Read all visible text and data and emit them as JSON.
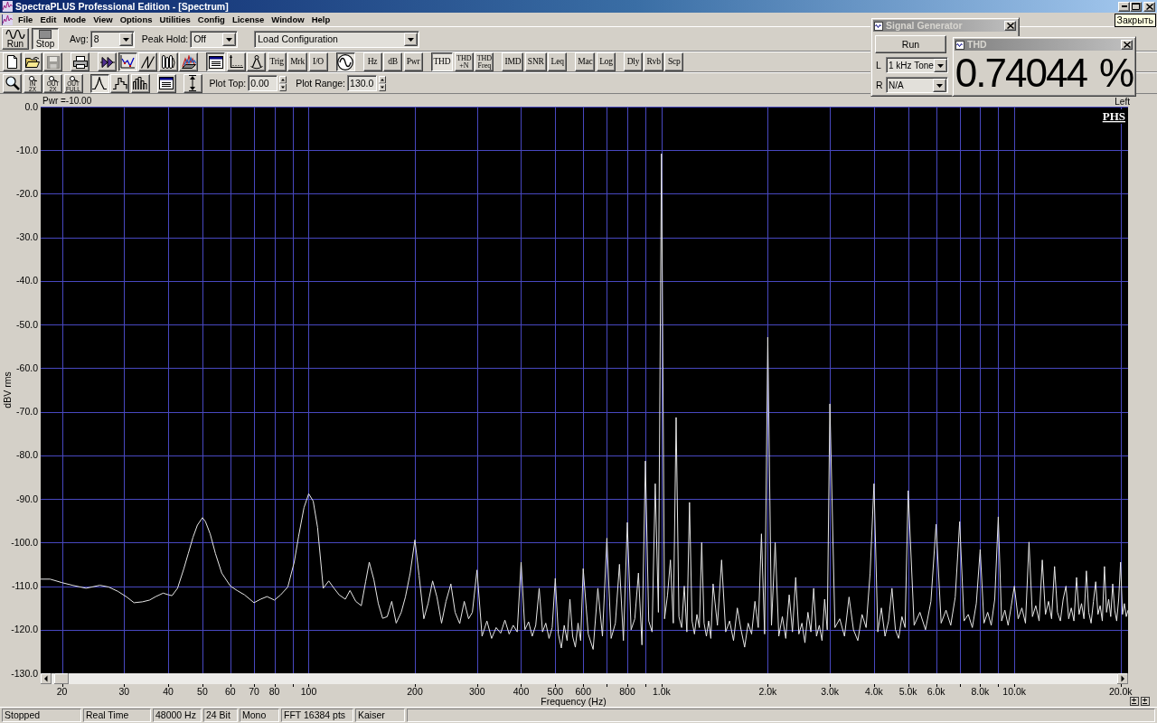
{
  "window": {
    "title": "SpectraPLUS Professional Edition - [Spectrum]",
    "tooltip": "Закрыть"
  },
  "menu": [
    "File",
    "Edit",
    "Mode",
    "View",
    "Options",
    "Utilities",
    "Config",
    "License",
    "Window",
    "Help"
  ],
  "main_toolbar": {
    "transport": [
      {
        "label": "Run",
        "pressed": false
      },
      {
        "label": "Stop",
        "pressed": true
      }
    ],
    "fields": [
      {
        "label": "Avg:",
        "value": "8"
      },
      {
        "label": "Peak Hold:",
        "value": "Off"
      },
      {
        "value": "Load Configuration"
      }
    ]
  },
  "tools_toolbar": {
    "groups": [
      {
        "buttons": [
          {
            "kind": "icon",
            "pressed": false,
            "disabled": false
          },
          {
            "kind": "icon",
            "pressed": false,
            "disabled": false
          },
          {
            "kind": "icon",
            "pressed": false,
            "disabled": true
          }
        ]
      },
      {
        "buttons": [
          {
            "kind": "icon",
            "pressed": false,
            "disabled": false
          }
        ]
      },
      {
        "buttons": [
          {
            "kind": "icon",
            "pressed": false,
            "disabled": false
          },
          {
            "kind": "icon",
            "pressed": true,
            "disabled": false
          },
          {
            "kind": "icon",
            "pressed": false,
            "disabled": false
          },
          {
            "kind": "icon",
            "pressed": false,
            "disabled": false
          },
          {
            "kind": "icon",
            "pressed": false,
            "disabled": false
          }
        ]
      },
      {
        "buttons": [
          {
            "kind": "icon",
            "pressed": true,
            "disabled": false
          },
          {
            "kind": "icon",
            "pressed": false,
            "disabled": false
          },
          {
            "kind": "icon",
            "pressed": false,
            "disabled": false
          },
          {
            "kind": "text",
            "label": "Trig",
            "pressed": false,
            "disabled": false
          },
          {
            "kind": "text",
            "label": "Mrk",
            "pressed": false,
            "disabled": false
          },
          {
            "kind": "text",
            "label": "I/O",
            "pressed": false,
            "disabled": false
          }
        ]
      },
      {
        "buttons": [
          {
            "kind": "icon",
            "pressed": true,
            "disabled": false
          }
        ]
      },
      {
        "buttons": [
          {
            "kind": "text",
            "label": "Hz",
            "pressed": false,
            "disabled": false
          },
          {
            "kind": "text",
            "label": "dB",
            "pressed": false,
            "disabled": false
          },
          {
            "kind": "text",
            "label": "Pwr",
            "pressed": false,
            "disabled": false
          }
        ]
      },
      {
        "buttons": [
          {
            "kind": "text",
            "label": "THD",
            "pressed": true,
            "disabled": false
          },
          {
            "kind": "stacked",
            "label": "THD +N",
            "pressed": false,
            "disabled": false
          },
          {
            "kind": "stacked",
            "label": "THD Freq",
            "pressed": false,
            "disabled": false
          }
        ]
      },
      {
        "buttons": [
          {
            "kind": "text",
            "label": "IMD",
            "pressed": false,
            "disabled": false
          },
          {
            "kind": "text",
            "label": "SNR",
            "pressed": false,
            "disabled": false
          },
          {
            "kind": "text",
            "label": "Leq",
            "pressed": false,
            "disabled": false
          }
        ]
      },
      {
        "buttons": [
          {
            "kind": "text",
            "label": "Mac",
            "pressed": false,
            "disabled": false
          },
          {
            "kind": "text",
            "label": "Log",
            "pressed": false,
            "disabled": false
          }
        ]
      },
      {
        "buttons": [
          {
            "kind": "text",
            "label": "Dly",
            "pressed": false,
            "disabled": false
          },
          {
            "kind": "text",
            "label": "Rvb",
            "pressed": false,
            "disabled": false
          },
          {
            "kind": "text",
            "label": "Scp",
            "pressed": false,
            "disabled": false
          }
        ]
      }
    ]
  },
  "view_toolbar": {
    "groups": [
      {
        "buttons": [
          {
            "kind": "icon",
            "pressed": false,
            "disabled": false
          },
          {
            "kind": "zoom",
            "label": "IN 2X",
            "pressed": false,
            "disabled": false
          },
          {
            "kind": "zoom",
            "label": "OUT 2X",
            "pressed": false,
            "disabled": false
          },
          {
            "kind": "zoom",
            "label": "OUT FULL",
            "pressed": false,
            "disabled": false
          }
        ]
      },
      {
        "buttons": [
          {
            "kind": "icon",
            "pressed": true,
            "disabled": false
          },
          {
            "kind": "icon",
            "pressed": false,
            "disabled": false
          },
          {
            "kind": "icon",
            "pressed": false,
            "disabled": false
          }
        ]
      },
      {
        "buttons": [
          {
            "kind": "icon",
            "pressed": false,
            "disabled": false
          }
        ]
      },
      {
        "buttons": [
          {
            "kind": "icon",
            "pressed": false,
            "disabled": false
          }
        ]
      }
    ],
    "fields": [
      {
        "label": "Plot Top:",
        "value": "0.00"
      },
      {
        "label": "Plot Range:",
        "value": "130.0"
      }
    ]
  },
  "spectrum": {
    "readout": "Pwr =-10.00",
    "logo": "PHS",
    "chart_data": {
      "type": "line",
      "xlabel": "Frequency (Hz)",
      "ylabel": "dBV rms",
      "log": "x",
      "grid": true,
      "xlim": [
        17.4,
        21000
      ],
      "ylim": [
        -130,
        0
      ],
      "xticks": [
        {
          "value": 20,
          "label": "20"
        },
        {
          "value": 30,
          "label": "30"
        },
        {
          "value": 40,
          "label": "40"
        },
        {
          "value": 50,
          "label": "50"
        },
        {
          "value": 60,
          "label": "60"
        },
        {
          "value": 70,
          "label": "70"
        },
        {
          "value": 80,
          "label": "80"
        },
        {
          "value": 100,
          "label": "100"
        },
        {
          "value": 200,
          "label": "200"
        },
        {
          "value": 300,
          "label": "300"
        },
        {
          "value": 400,
          "label": "400"
        },
        {
          "value": 500,
          "label": "500"
        },
        {
          "value": 600,
          "label": "600"
        },
        {
          "value": 800,
          "label": "800"
        },
        {
          "value": 1000,
          "label": "1.0k"
        },
        {
          "value": 2000,
          "label": "2.0k"
        },
        {
          "value": 3000,
          "label": "3.0k"
        },
        {
          "value": 4000,
          "label": "4.0k"
        },
        {
          "value": 5000,
          "label": "5.0k"
        },
        {
          "value": 6000,
          "label": "6.0k"
        },
        {
          "value": 8000,
          "label": "8.0k"
        },
        {
          "value": 10000,
          "label": "10.0k"
        },
        {
          "value": 20000,
          "label": "20.0k"
        }
      ],
      "yticks": [
        {
          "value": 0,
          "label": "0.0"
        },
        {
          "value": -10,
          "label": "-10.0"
        },
        {
          "value": -20,
          "label": "-20.0"
        },
        {
          "value": -30,
          "label": "-30.0"
        },
        {
          "value": -40,
          "label": "-40.0"
        },
        {
          "value": -50,
          "label": "-50.0"
        },
        {
          "value": -60,
          "label": "-60.0"
        },
        {
          "value": -70,
          "label": "-70.0"
        },
        {
          "value": -80,
          "label": "-80.0"
        },
        {
          "value": -90,
          "label": "-90.0"
        },
        {
          "value": -100,
          "label": "-100.0"
        },
        {
          "value": -110,
          "label": "-110.0"
        },
        {
          "value": -120,
          "label": "-120.0"
        },
        {
          "value": -130,
          "label": "-130.0"
        }
      ],
      "x": [
        17.4,
        18.5,
        20,
        21.4,
        23.4,
        25.6,
        27.1,
        28.8,
        30.5,
        32,
        33.8,
        35.4,
        36.9,
        38.7,
        40.1,
        41,
        42.5,
        44.3,
        45.6,
        47,
        48.4,
        50,
        51,
        52.6,
        54.4,
        56.7,
        60,
        62.7,
        65.8,
        70,
        73.1,
        76.2,
        80,
        83.3,
        87.3,
        91,
        93.7,
        97,
        100,
        103,
        106,
        110,
        114,
        118,
        122,
        127,
        131,
        136,
        141,
        145,
        148.5,
        153,
        157.5,
        162,
        167,
        172,
        177,
        183,
        188,
        194,
        200,
        205.5,
        212,
        218,
        224.5,
        231,
        238,
        245,
        253,
        260,
        268,
        276,
        284,
        291,
        300,
        310,
        320,
        330,
        340,
        350,
        360,
        370,
        380,
        390,
        400,
        410,
        420,
        430,
        440,
        450,
        460,
        470,
        480,
        490,
        500,
        510,
        520,
        530,
        540,
        550,
        560,
        570,
        580,
        590,
        600,
        620,
        640,
        660,
        680,
        700,
        720,
        740,
        760,
        780,
        800,
        820,
        840,
        860,
        880,
        900,
        920,
        940,
        960,
        980,
        1000,
        1020,
        1040,
        1060,
        1080,
        1100,
        1120,
        1140,
        1160,
        1180,
        1200,
        1220,
        1240,
        1260,
        1280,
        1300,
        1320,
        1340,
        1360,
        1380,
        1400,
        1440,
        1480,
        1520,
        1560,
        1600,
        1640,
        1680,
        1720,
        1760,
        1800,
        1840,
        1880,
        1920,
        1960,
        2000,
        2050,
        2100,
        2150,
        2200,
        2250,
        2300,
        2350,
        2400,
        2450,
        2500,
        2550,
        2600,
        2650,
        2700,
        2750,
        2800,
        2850,
        2900,
        2950,
        3000,
        3100,
        3200,
        3300,
        3400,
        3500,
        3600,
        3700,
        3800,
        3900,
        4000,
        4100,
        4200,
        4300,
        4400,
        4500,
        4600,
        4700,
        4800,
        4900,
        5000,
        5200,
        5400,
        5600,
        5800,
        6000,
        6200,
        6400,
        6600,
        6800,
        7000,
        7200,
        7400,
        7600,
        7800,
        8000,
        8200,
        8400,
        8600,
        8800,
        9000,
        9200,
        9400,
        9600,
        9800,
        10000,
        10250,
        10500,
        10750,
        11000,
        11250,
        11500,
        11750,
        12000,
        12250,
        12500,
        12750,
        13000,
        13250,
        13500,
        13750,
        14000,
        14250,
        14500,
        14750,
        15000,
        15250,
        15500,
        15750,
        16000,
        16250,
        16500,
        16750,
        17000,
        17250,
        17500,
        17750,
        18000,
        18250,
        18500,
        18750,
        19000,
        19250,
        19500,
        19750,
        20000,
        20250,
        20500,
        20750,
        21000
      ],
      "series": [
        {
          "name": "Left",
          "color": "#e6e6e6",
          "values": [
            -108.4,
            -108.4,
            -109.2,
            -109.8,
            -110.5,
            -109.8,
            -110.2,
            -111.2,
            -112.5,
            -113.8,
            -113.6,
            -113.2,
            -112.4,
            -111.6,
            -112.0,
            -112.2,
            -110.5,
            -106.0,
            -102.5,
            -98.8,
            -96.0,
            -94.3,
            -95.2,
            -98.0,
            -102.5,
            -107.0,
            -110.0,
            -111.0,
            -112.0,
            -113.8,
            -113.0,
            -112.4,
            -113.2,
            -112.0,
            -110.2,
            -104.5,
            -98.5,
            -92.0,
            -88.8,
            -90.5,
            -96.5,
            -110.5,
            -108.8,
            -110.5,
            -112.0,
            -113.0,
            -111.0,
            -113.5,
            -114.5,
            -109.0,
            -104.5,
            -108.5,
            -114.0,
            -117.4,
            -117.0,
            -113.5,
            -118.5,
            -116.0,
            -112.5,
            -107.0,
            -99.4,
            -107.5,
            -117.5,
            -114.0,
            -108.8,
            -112.5,
            -118.5,
            -113.5,
            -109.5,
            -116.0,
            -118.6,
            -113.5,
            -117.5,
            -116.0,
            -106.3,
            -121.5,
            -118.0,
            -122.0,
            -119.5,
            -120.8,
            -117.8,
            -121.0,
            -119.0,
            -120.5,
            -104.5,
            -120.0,
            -118.2,
            -121.5,
            -119.0,
            -110.5,
            -120.5,
            -118.5,
            -122.0,
            -119.5,
            -108.2,
            -121.0,
            -124.2,
            -119.0,
            -122.5,
            -113.0,
            -121.5,
            -124.0,
            -118.5,
            -122.5,
            -106.0,
            -121.0,
            -124.5,
            -110.5,
            -121.5,
            -99.0,
            -122.0,
            -118.5,
            -105.0,
            -122.5,
            -95.4,
            -120.0,
            -117.5,
            -107.0,
            -123.5,
            -81.3,
            -118.0,
            -120.5,
            -86.5,
            -116.0,
            -10.8,
            -117.5,
            -112.0,
            -104.0,
            -118.5,
            -71.3,
            -117.0,
            -119.5,
            -110.0,
            -120.5,
            -90.8,
            -118.0,
            -121.0,
            -116.5,
            -119.5,
            -100.0,
            -118.5,
            -121.5,
            -118.0,
            -122.0,
            -109.5,
            -119.0,
            -104.0,
            -120.5,
            -118.0,
            -122.5,
            -115.0,
            -120.0,
            -124.0,
            -118.5,
            -121.0,
            -113.5,
            -119.5,
            -98.0,
            -121.0,
            -52.9,
            -119.0,
            -100.0,
            -121.5,
            -117.0,
            -122.0,
            -112.0,
            -120.5,
            -108.0,
            -121.0,
            -118.5,
            -123.0,
            -116.0,
            -120.5,
            -110.5,
            -121.5,
            -119.0,
            -122.5,
            -113.0,
            -120.0,
            -68.2,
            -119.5,
            -117.5,
            -121.5,
            -112.5,
            -120.0,
            -122.5,
            -116.5,
            -119.5,
            -107.0,
            -86.5,
            -120.5,
            -115.0,
            -121.5,
            -118.0,
            -110.5,
            -120.0,
            -122.0,
            -117.0,
            -119.5,
            -88.1,
            -119.0,
            -116.0,
            -120.0,
            -113.5,
            -95.8,
            -118.5,
            -115.5,
            -119.0,
            -112.5,
            -95.2,
            -118.0,
            -116.5,
            -119.5,
            -114.0,
            -101.6,
            -118.5,
            -116.0,
            -119.0,
            -113.0,
            -94.1,
            -118.0,
            -115.5,
            -119.0,
            -114.5,
            -110.0,
            -117.5,
            -115.0,
            -118.5,
            -99.9,
            -117.0,
            -114.5,
            -118.0,
            -104.0,
            -116.5,
            -113.5,
            -117.5,
            -105.5,
            -116.0,
            -118.0,
            -113.0,
            -110.0,
            -117.5,
            -115.0,
            -118.0,
            -108.0,
            -116.5,
            -114.0,
            -117.5,
            -106.5,
            -116.0,
            -118.5,
            -113.5,
            -109.0,
            -116.5,
            -114.5,
            -118.0,
            -105.5,
            -116.0,
            -113.0,
            -117.0,
            -109.5,
            -115.5,
            -118.0,
            -113.0,
            -104.5,
            -116.5,
            -114.0,
            -117.0,
            -115.5
          ]
        }
      ]
    }
  },
  "status_bar": [
    "Stopped",
    "Real Time",
    "48000 Hz",
    "24 Bit",
    "Mono",
    "FFT 16384 pts",
    "Kaiser"
  ],
  "signal_generator": {
    "title": "Signal Generator",
    "run_label": "Run",
    "channels": [
      {
        "label": "L",
        "value": "1 kHz Tone"
      },
      {
        "label": "R",
        "value": "N/A"
      }
    ]
  },
  "thd_window": {
    "title": "THD",
    "value": "0.74044 %"
  }
}
